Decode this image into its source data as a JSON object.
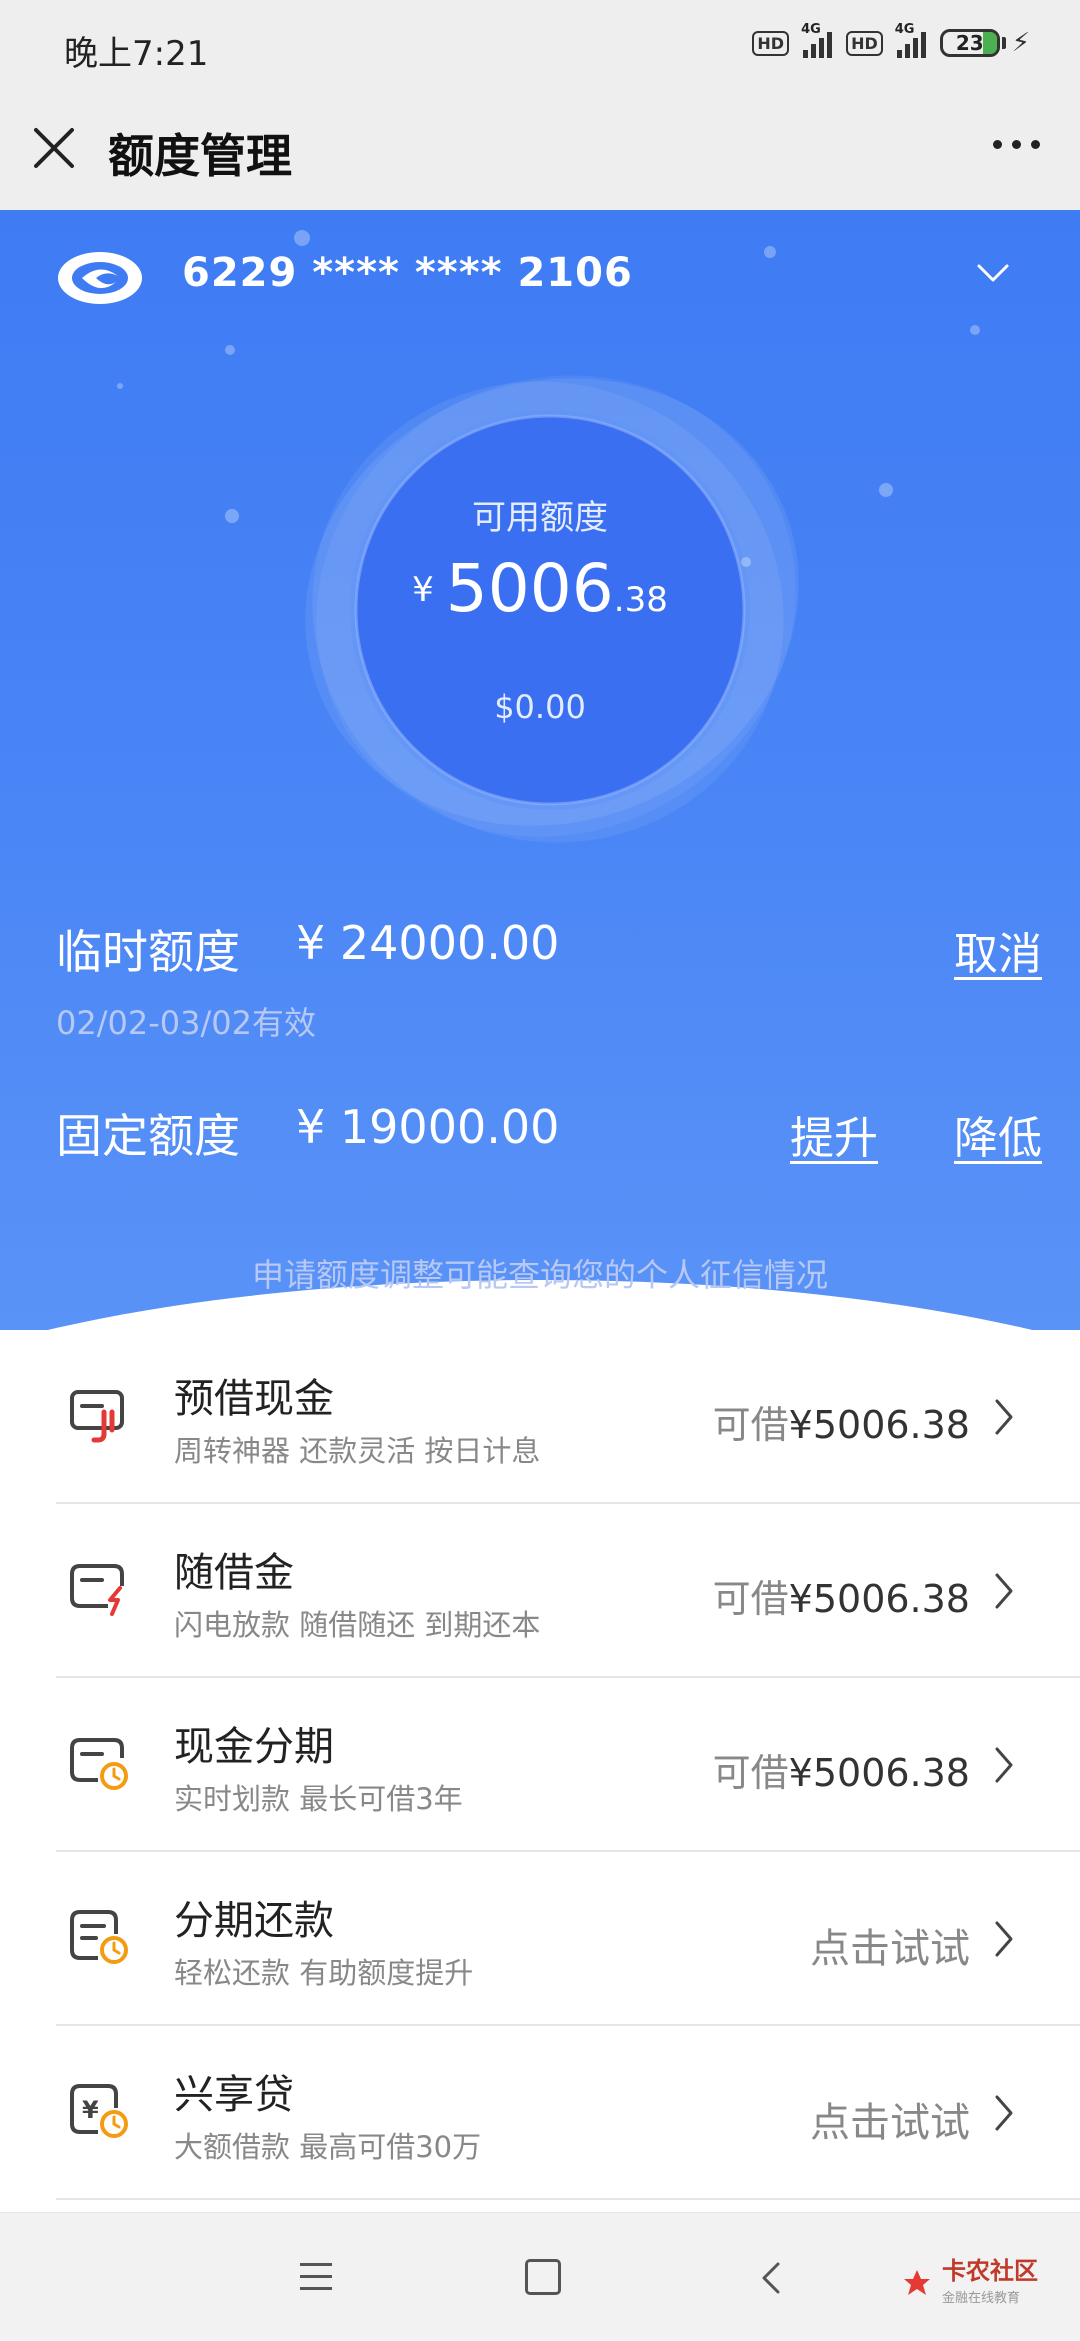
{
  "status_bar": {
    "time": "晚上7:21",
    "hd_1": "HD",
    "net_1": "4G",
    "hd_2": "HD",
    "net_2": "4G",
    "battery": "23"
  },
  "nav": {
    "title": "额度管理"
  },
  "card": {
    "number": "6229 **** **** 2106"
  },
  "available": {
    "label": "可用额度",
    "currency": "¥",
    "integer": "5006",
    "decimal": ".38",
    "usd": "$0.00"
  },
  "temp_limit": {
    "label": "临时额度",
    "value": "¥ 24000.00",
    "cancel": "取消",
    "validity": "02/02-03/02有效"
  },
  "fixed_limit": {
    "label": "固定额度",
    "value": "¥ 19000.00",
    "raise": "提升",
    "lower": "降低"
  },
  "notice": "申请额度调整可能查询您的个人征信情况",
  "items": [
    {
      "title": "预借现金",
      "subtitle": "周转神器 还款灵活 按日计息",
      "prefix": "可借",
      "amount": "¥5006.38",
      "icon": "cash-advance-icon"
    },
    {
      "title": "随借金",
      "subtitle": "闪电放款 随借随还 到期还本",
      "prefix": "可借",
      "amount": "¥5006.38",
      "icon": "instant-loan-icon"
    },
    {
      "title": "现金分期",
      "subtitle": "实时划款 最长可借3年",
      "prefix": "可借",
      "amount": "¥5006.38",
      "icon": "cash-installment-icon"
    },
    {
      "title": "分期还款",
      "subtitle": "轻松还款 有助额度提升",
      "action": "点击试试",
      "icon": "installment-repay-icon"
    },
    {
      "title": "兴享贷",
      "subtitle": "大额借款 最高可借30万",
      "action": "点击试试",
      "icon": "loan-icon"
    }
  ],
  "watermark": {
    "title": "卡农社区",
    "subtitle": "金融在线教育"
  },
  "colors": {
    "hero": "#4a86f6",
    "accent_red": "#e53935",
    "accent_orange": "#f39c12"
  }
}
